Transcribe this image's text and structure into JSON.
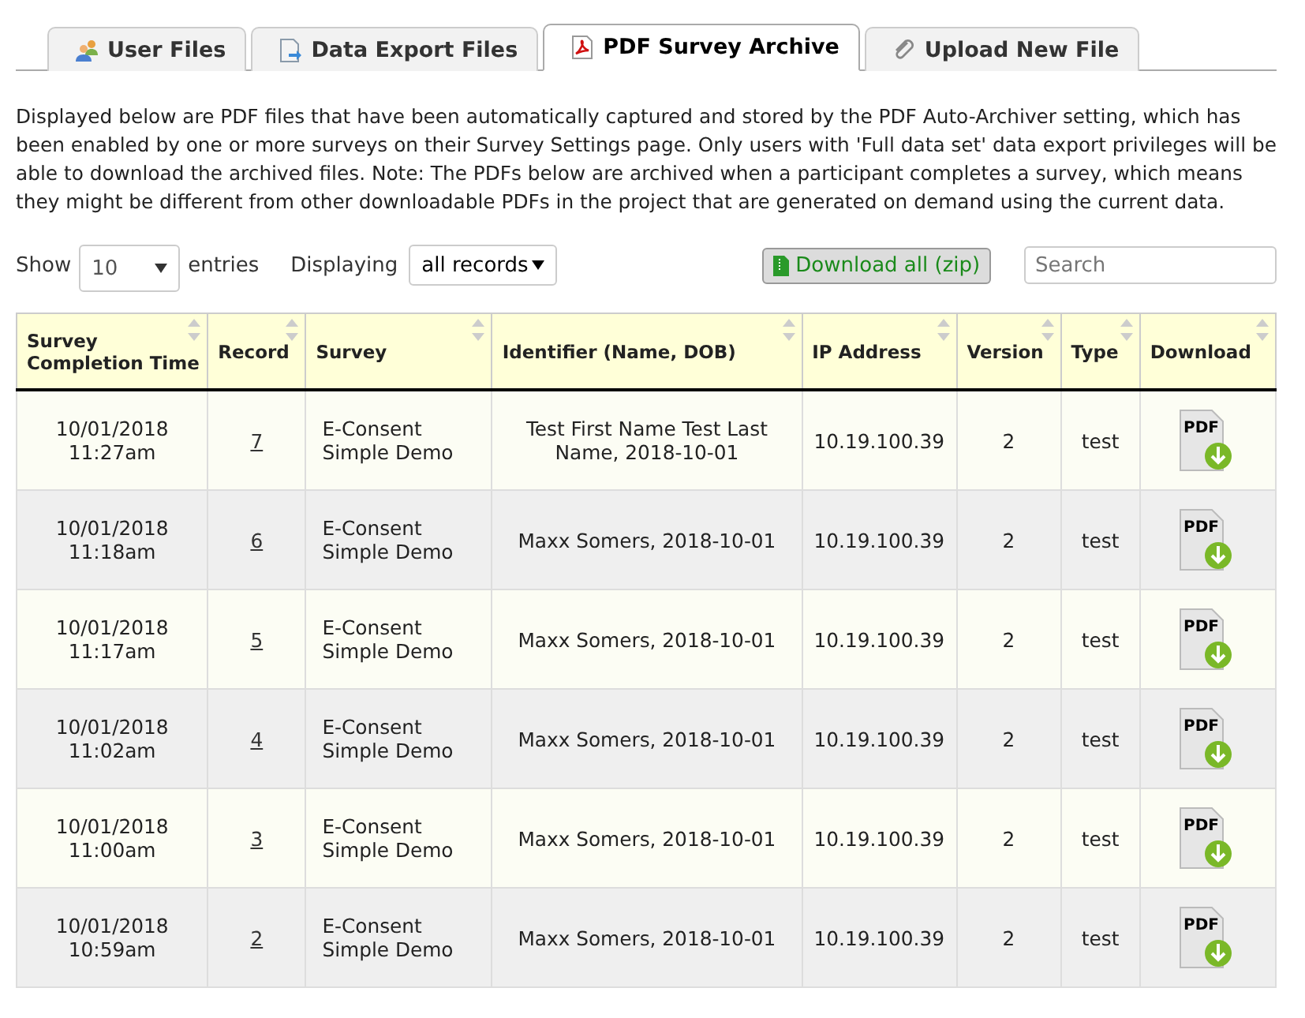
{
  "tabs": [
    {
      "label": "User Files",
      "selected": false
    },
    {
      "label": "Data Export Files",
      "selected": false
    },
    {
      "label": "PDF Survey Archive",
      "selected": true
    },
    {
      "label": "Upload New File",
      "selected": false
    }
  ],
  "description": "Displayed below are PDF files that have been automatically captured and stored by the PDF Auto-Archiver setting, which has been enabled by one or more surveys on their Survey Settings page. Only users with 'Full data set' data export privileges will be able to download the archived files. Note: The PDFs below are archived when a participant completes a survey, which means they might be different from other downloadable PDFs in the project that are generated on demand using the current data.",
  "controls": {
    "show_label": "Show",
    "page_size": "10",
    "entries_label": "entries",
    "displaying_label": "Displaying",
    "displaying_value": "all records",
    "download_all": "Download all (zip)",
    "search": {
      "placeholder": "Search"
    }
  },
  "table": {
    "columns": [
      "Survey Completion Time",
      "Record",
      "Survey",
      "Identifier (Name, DOB)",
      "IP Address",
      "Version",
      "Type",
      "Download"
    ],
    "rows": [
      {
        "time": "10/01/2018 11:27am",
        "record": "7",
        "survey": "E-Consent Simple Demo",
        "identifier": "Test First Name Test Last Name, 2018-10-01",
        "ip": "10.19.100.39",
        "version": "2",
        "type": "test",
        "download": "PDF"
      },
      {
        "time": "10/01/2018 11:18am",
        "record": "6",
        "survey": "E-Consent Simple Demo",
        "identifier": "Maxx Somers, 2018-10-01",
        "ip": "10.19.100.39",
        "version": "2",
        "type": "test",
        "download": "PDF"
      },
      {
        "time": "10/01/2018 11:17am",
        "record": "5",
        "survey": "E-Consent Simple Demo",
        "identifier": "Maxx Somers, 2018-10-01",
        "ip": "10.19.100.39",
        "version": "2",
        "type": "test",
        "download": "PDF"
      },
      {
        "time": "10/01/2018 11:02am",
        "record": "4",
        "survey": "E-Consent Simple Demo",
        "identifier": "Maxx Somers, 2018-10-01",
        "ip": "10.19.100.39",
        "version": "2",
        "type": "test",
        "download": "PDF"
      },
      {
        "time": "10/01/2018 11:00am",
        "record": "3",
        "survey": "E-Consent Simple Demo",
        "identifier": "Maxx Somers, 2018-10-01",
        "ip": "10.19.100.39",
        "version": "2",
        "type": "test",
        "download": "PDF"
      },
      {
        "time": "10/01/2018 10:59am",
        "record": "2",
        "survey": "E-Consent Simple Demo",
        "identifier": "Maxx Somers, 2018-10-01",
        "ip": "10.19.100.39",
        "version": "2",
        "type": "test",
        "download": "PDF"
      }
    ]
  }
}
